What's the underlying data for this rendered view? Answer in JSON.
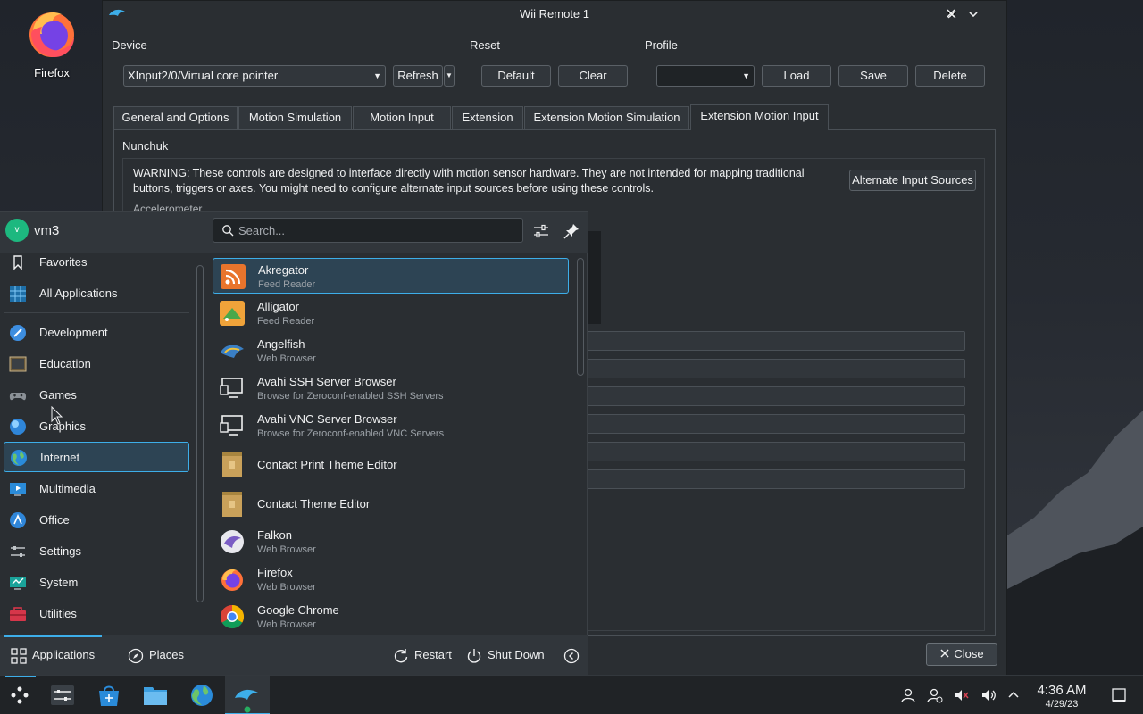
{
  "desktop": {
    "firefox_label": "Firefox"
  },
  "wii_window": {
    "title": "Wii Remote 1",
    "device": {
      "label": "Device",
      "selected": "XInput2/0/Virtual core pointer",
      "refresh": "Refresh"
    },
    "reset": {
      "label": "Reset",
      "default": "Default",
      "clear": "Clear"
    },
    "profile": {
      "label": "Profile",
      "selected": "",
      "load": "Load",
      "save": "Save",
      "delete": "Delete"
    },
    "tabs": [
      {
        "label": "General and Options"
      },
      {
        "label": "Motion Simulation"
      },
      {
        "label": "Motion Input"
      },
      {
        "label": "Extension"
      },
      {
        "label": "Extension Motion Simulation"
      },
      {
        "label": "Extension Motion Input"
      }
    ],
    "group_title": "Nunchuk",
    "warning": "WARNING: These controls are designed to interface directly with motion sensor hardware. They are not intended for mapping traditional buttons, triggers or axes. You might need to configure alternate input sources before using these controls.",
    "alt_sources": "Alternate Input Sources",
    "accelerometer": "Accelerometer",
    "close": "Close"
  },
  "kickoff": {
    "user": "vm3",
    "avatar_letter": "v",
    "search_placeholder": "Search...",
    "categories": [
      {
        "label": "Favorites"
      },
      {
        "label": "All Applications"
      },
      {
        "label": "Development"
      },
      {
        "label": "Education"
      },
      {
        "label": "Games"
      },
      {
        "label": "Graphics"
      },
      {
        "label": "Internet"
      },
      {
        "label": "Multimedia"
      },
      {
        "label": "Office"
      },
      {
        "label": "Settings"
      },
      {
        "label": "System"
      },
      {
        "label": "Utilities"
      }
    ],
    "apps": [
      {
        "name": "Akregator",
        "desc": "Feed Reader"
      },
      {
        "name": "Alligator",
        "desc": "Feed Reader"
      },
      {
        "name": "Angelfish",
        "desc": "Web Browser"
      },
      {
        "name": "Avahi SSH Server Browser",
        "desc": "Browse for Zeroconf-enabled SSH Servers"
      },
      {
        "name": "Avahi VNC Server Browser",
        "desc": "Browse for Zeroconf-enabled VNC Servers"
      },
      {
        "name": "Contact Print Theme Editor",
        "desc": ""
      },
      {
        "name": "Contact Theme Editor",
        "desc": ""
      },
      {
        "name": "Falkon",
        "desc": "Web Browser"
      },
      {
        "name": "Firefox",
        "desc": "Web Browser"
      },
      {
        "name": "Google Chrome",
        "desc": "Web Browser"
      }
    ],
    "footer": {
      "applications": "Applications",
      "places": "Places",
      "restart": "Restart",
      "shutdown": "Shut Down"
    }
  },
  "taskbar": {
    "time": "4:36 AM",
    "date": "4/29/23"
  },
  "colors": {
    "accent": "#3daee9",
    "selection_bg": "#2d4454",
    "window_bg": "#2a2e32"
  }
}
